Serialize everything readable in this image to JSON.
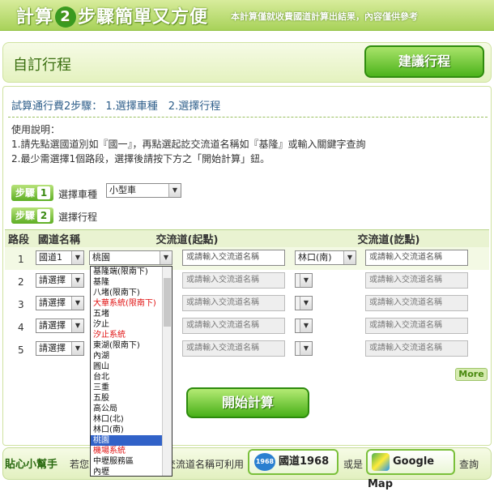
{
  "header": {
    "title_part1": "計算",
    "step_number": "2",
    "title_part2": "步驟簡單又方便",
    "note": "本計算僅就收費國道計算出結果，內容僅供參考"
  },
  "band": {
    "label": "自訂行程",
    "suggest_button": "建議行程"
  },
  "subtitle": "試算通行費2步驟： 1.選擇車種　2.選擇行程",
  "usage": {
    "line1": "使用說明：",
    "line2": "1.請先點選國道別如『國一』，再點選起訖交流道名稱如『基隆』或輸入關鍵字查詢",
    "line3": "2.最少需選擇1個路段，選擇後請按下方之「開始計算」鈕。"
  },
  "step1": {
    "badge": "步驟",
    "num": "1",
    "label": "選擇車種",
    "vehicle": "小型車"
  },
  "step2": {
    "badge": "步驟",
    "num": "2",
    "label": "選擇行程"
  },
  "table": {
    "headers": [
      "路段",
      "國道名稱",
      "交流道(起點)",
      "交流道(訖點)"
    ],
    "placeholder": "或請輸入交流道名稱",
    "rows": [
      {
        "n": "1",
        "road": "國道1",
        "start": "桃園",
        "end": "林口(南)"
      },
      {
        "n": "2",
        "road": "請選擇",
        "start": "",
        "end": ""
      },
      {
        "n": "3",
        "road": "請選擇",
        "start": "",
        "end": ""
      },
      {
        "n": "4",
        "road": "請選擇",
        "start": "",
        "end": ""
      },
      {
        "n": "5",
        "road": "請選擇",
        "start": "",
        "end": ""
      }
    ]
  },
  "more": "More",
  "start_button": "開始計算",
  "footer": {
    "helper": "貼心小幫手",
    "text_a": "若您",
    "text_b": "交流道名稱可利用",
    "chip1_badge": "1968",
    "chip1": "國道1968",
    "text_c": "或是",
    "chip2": "Google Map",
    "text_d": "查詢"
  },
  "dropdown": {
    "options": [
      "基隆端(限南下)",
      "基隆",
      "八堵(限南下)",
      "大華系統(限南下)",
      "五堵",
      "汐止",
      "汐止系統",
      "東湖(限南下)",
      "內湖",
      "圓山",
      "台北",
      "三重",
      "五股",
      "高公局",
      "林口(北)",
      "林口(南)",
      "桃園",
      "機場系統",
      "中壢服務區",
      "內壢"
    ],
    "red": [
      3,
      6,
      17
    ],
    "selected": 16
  }
}
